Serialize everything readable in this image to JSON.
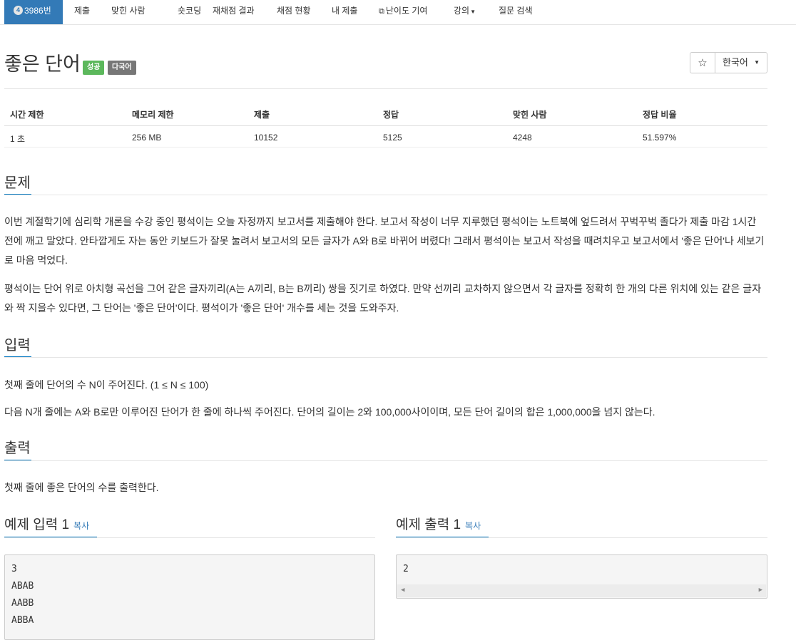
{
  "nav": {
    "problem_number": "3986번",
    "tier_badge": "4",
    "items": [
      "제출",
      "맞힌 사람",
      "숏코딩",
      "재채점 결과",
      "채점 현황",
      "내 제출",
      "난이도 기여",
      "강의",
      "질문 검색"
    ]
  },
  "problem": {
    "title": "좋은 단어",
    "badge_success": "성공",
    "badge_language": "다국어",
    "star": "☆",
    "language": "한국어"
  },
  "stats": {
    "headers": [
      "시간 제한",
      "메모리 제한",
      "제출",
      "정답",
      "맞힌 사람",
      "정답 비율"
    ],
    "values": [
      "1 초",
      "256 MB",
      "10152",
      "5125",
      "4248",
      "51.597%"
    ]
  },
  "sections": {
    "description_title": "문제",
    "description_p1": "이번 계절학기에 심리학 개론을 수강 중인 평석이는 오늘 자정까지 보고서를 제출해야 한다. 보고서 작성이 너무 지루했던 평석이는 노트북에 엎드려서 꾸벅꾸벅 졸다가 제출 마감 1시간 전에 깨고 말았다. 안타깝게도 자는 동안 키보드가 잘못 눌려서 보고서의 모든 글자가 A와 B로 바뀌어 버렸다! 그래서 평석이는 보고서 작성을 때려치우고 보고서에서 '좋은 단어'나 세보기로 마음 먹었다.",
    "description_p2": "평석이는 단어 위로 아치형 곡선을 그어 같은 글자끼리(A는 A끼리, B는 B끼리) 쌍을 짓기로 하였다. 만약 선끼리 교차하지 않으면서 각 글자를 정확히 한 개의 다른 위치에 있는 같은 글자와 짝 지을수 있다면, 그 단어는 '좋은 단어'이다. 평석이가 '좋은 단어' 개수를 세는 것을 도와주자.",
    "input_title": "입력",
    "input_p1": "첫째 줄에 단어의 수 N이 주어진다. (1 ≤ N ≤ 100)",
    "input_p2": "다음 N개 줄에는 A와 B로만 이루어진 단어가 한 줄에 하나씩 주어진다. 단어의 길이는 2와 100,000사이이며, 모든 단어 길이의 합은 1,000,000을 넘지 않는다.",
    "output_title": "출력",
    "output_p1": "첫째 줄에 좋은 단어의 수를 출력한다."
  },
  "examples": {
    "input_title": "예제 입력 1",
    "output_title": "예제 출력 1",
    "copy_label": "복사",
    "input_lines": [
      "3",
      "ABAB",
      "AABB",
      "ABBA"
    ],
    "output_lines": [
      "2"
    ]
  }
}
